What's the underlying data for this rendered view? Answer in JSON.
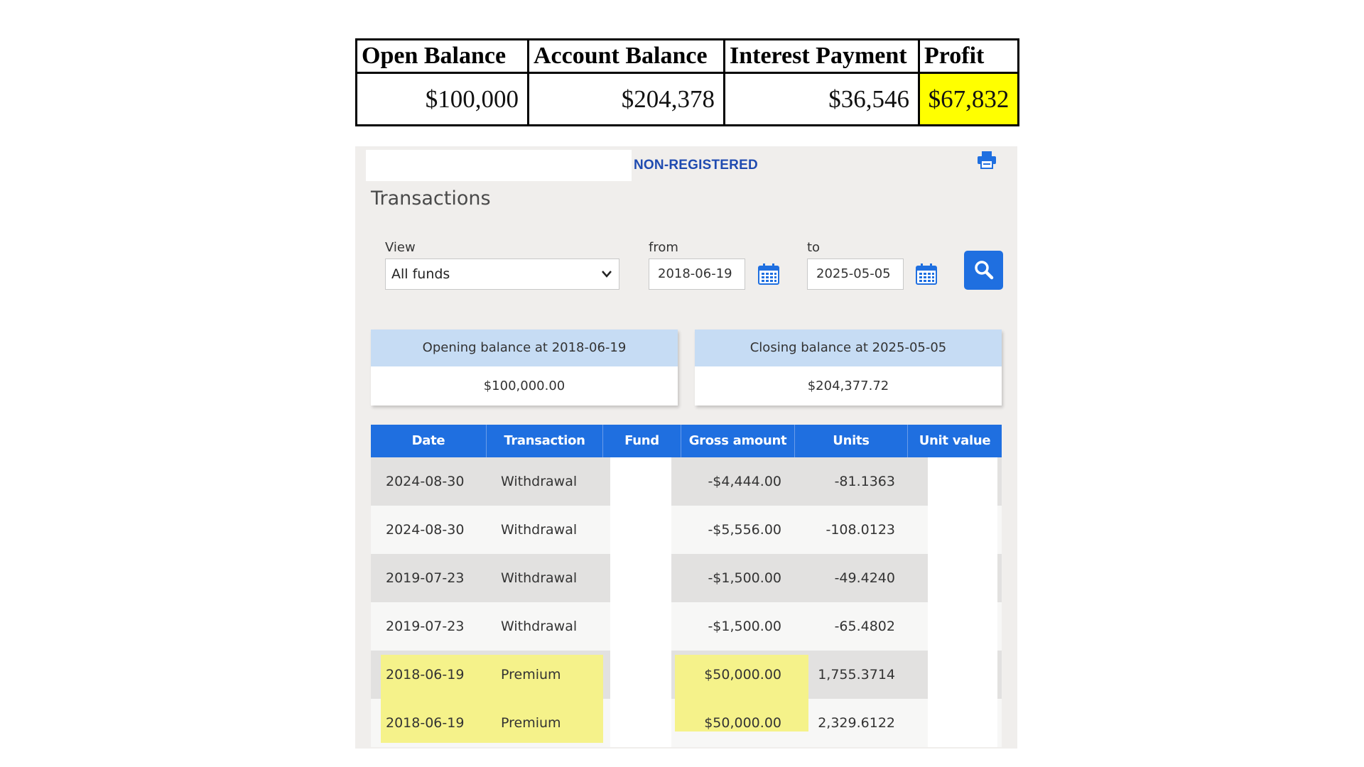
{
  "summary": {
    "headers": [
      "Open Balance",
      "Account Balance",
      "Interest Payment",
      "Profit"
    ],
    "values": [
      "$100,000",
      "$204,378",
      "$36,546",
      "$67,832"
    ],
    "highlight_color": "#ffff00"
  },
  "account": {
    "type_label": "NON-REGISTERED",
    "print_icon": "printer-icon"
  },
  "transactions": {
    "title": "Transactions",
    "view_label": "View",
    "view_value": "All funds",
    "from_label": "from",
    "from_value": "2018-06-19",
    "to_label": "to",
    "to_value": "2025-05-05",
    "calendar_icon": "calendar-icon",
    "search_icon": "search-icon",
    "accent_color": "#1f6fe0"
  },
  "balances": {
    "opening_label": "Opening balance at 2018-06-19",
    "opening_value": "$100,000.00",
    "closing_label": "Closing balance at 2025-05-05",
    "closing_value": "$204,377.72"
  },
  "table": {
    "columns": [
      "Date",
      "Transaction",
      "Fund",
      "Gross amount",
      "Units",
      "Unit value"
    ],
    "rows": [
      {
        "date": "2024-08-30",
        "transaction": "Withdrawal",
        "fund": "",
        "gross": "-$4,444.00",
        "units": "-81.1363",
        "unit_value": ""
      },
      {
        "date": "2024-08-30",
        "transaction": "Withdrawal",
        "fund": "",
        "gross": "-$5,556.00",
        "units": "-108.0123",
        "unit_value": ""
      },
      {
        "date": "2019-07-23",
        "transaction": "Withdrawal",
        "fund": "",
        "gross": "-$1,500.00",
        "units": "-49.4240",
        "unit_value": ""
      },
      {
        "date": "2019-07-23",
        "transaction": "Withdrawal",
        "fund": "",
        "gross": "-$1,500.00",
        "units": "-65.4802",
        "unit_value": ""
      },
      {
        "date": "2018-06-19",
        "transaction": "Premium",
        "fund": "",
        "gross": "$50,000.00",
        "units": "1,755.3714",
        "unit_value": ""
      },
      {
        "date": "2018-06-19",
        "transaction": "Premium",
        "fund": "",
        "gross": "$50,000.00",
        "units": "2,329.6122",
        "unit_value": ""
      }
    ],
    "highlight_color": "#f5f28a"
  }
}
